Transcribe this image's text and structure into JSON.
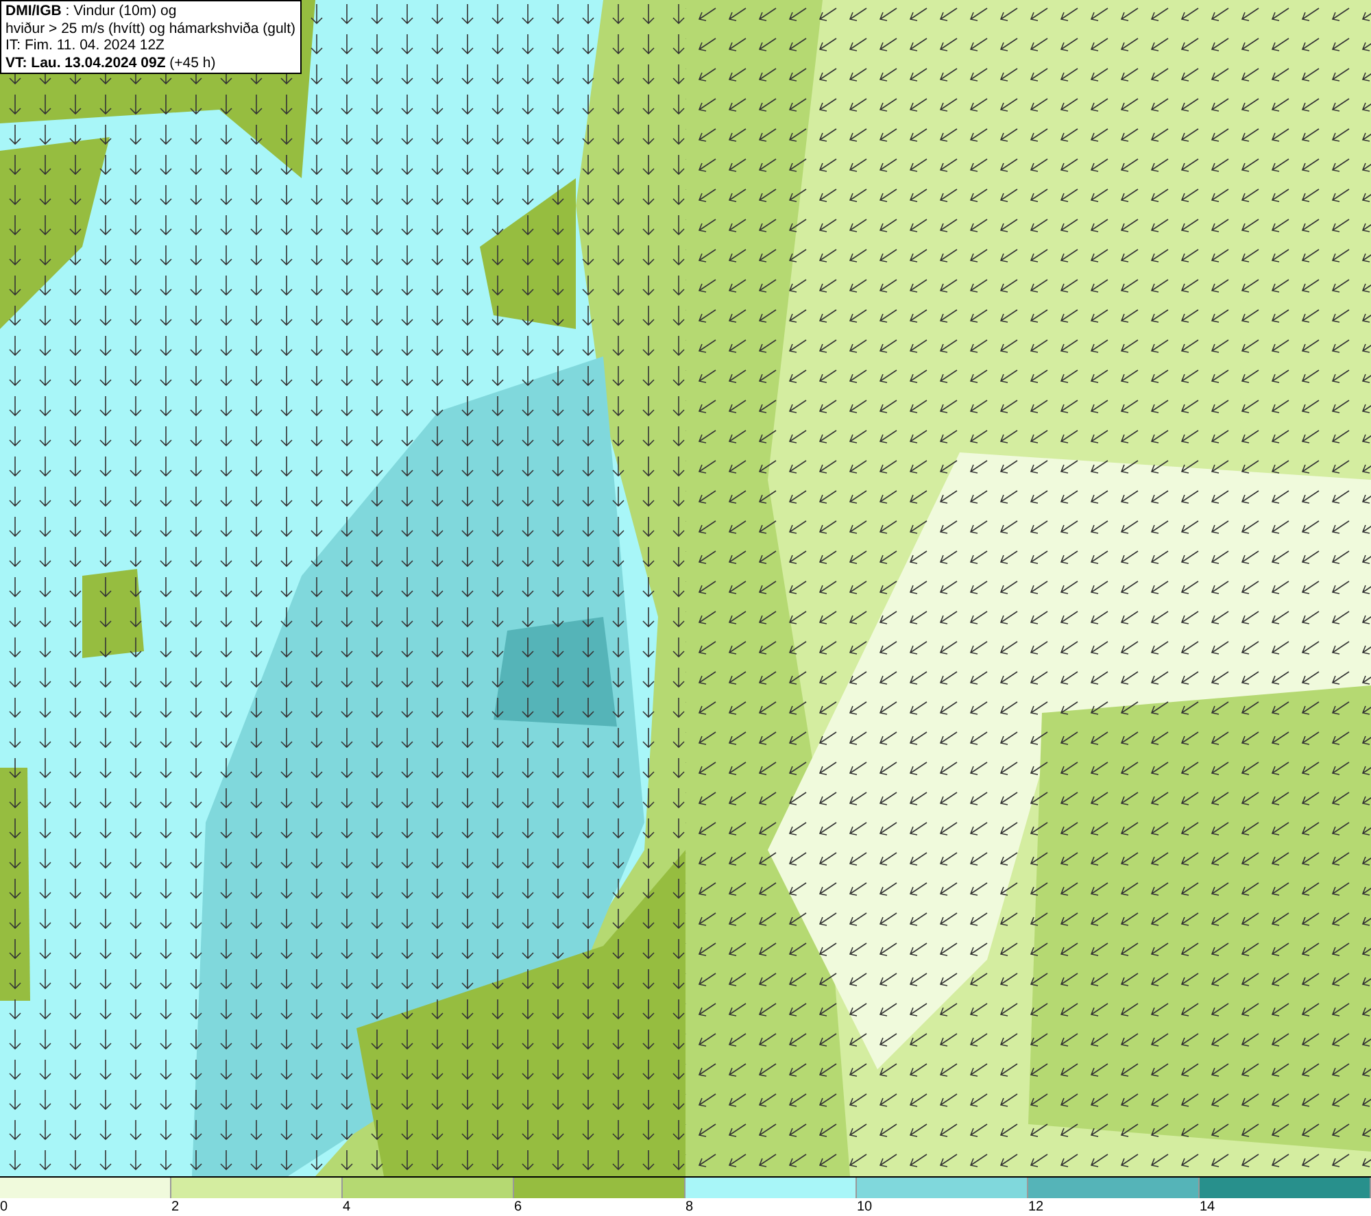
{
  "header": {
    "lines": [
      "**DMI/IGB** : Vindur (10m) og",
      "hviður > 25 m/s (hvítt) og hámarkshviða (gult)",
      "IT: Fim. 11. 04. 2024 12Z",
      "**VT: Lau. 13.04.2024 09Z** (+45 h)"
    ]
  },
  "legend": {
    "bins": [
      {
        "color": "#f0fadc"
      },
      {
        "color": "#d4eda0"
      },
      {
        "color": "#b5d972"
      },
      {
        "color": "#96bd40"
      },
      {
        "color": "#a8f6f8"
      },
      {
        "color": "#80d8dc"
      },
      {
        "color": "#55b4b8"
      },
      {
        "color": "#28908c"
      }
    ],
    "ticks": [
      "0",
      "2",
      "4",
      "6",
      "8",
      "10",
      "12",
      "14"
    ]
  }
}
